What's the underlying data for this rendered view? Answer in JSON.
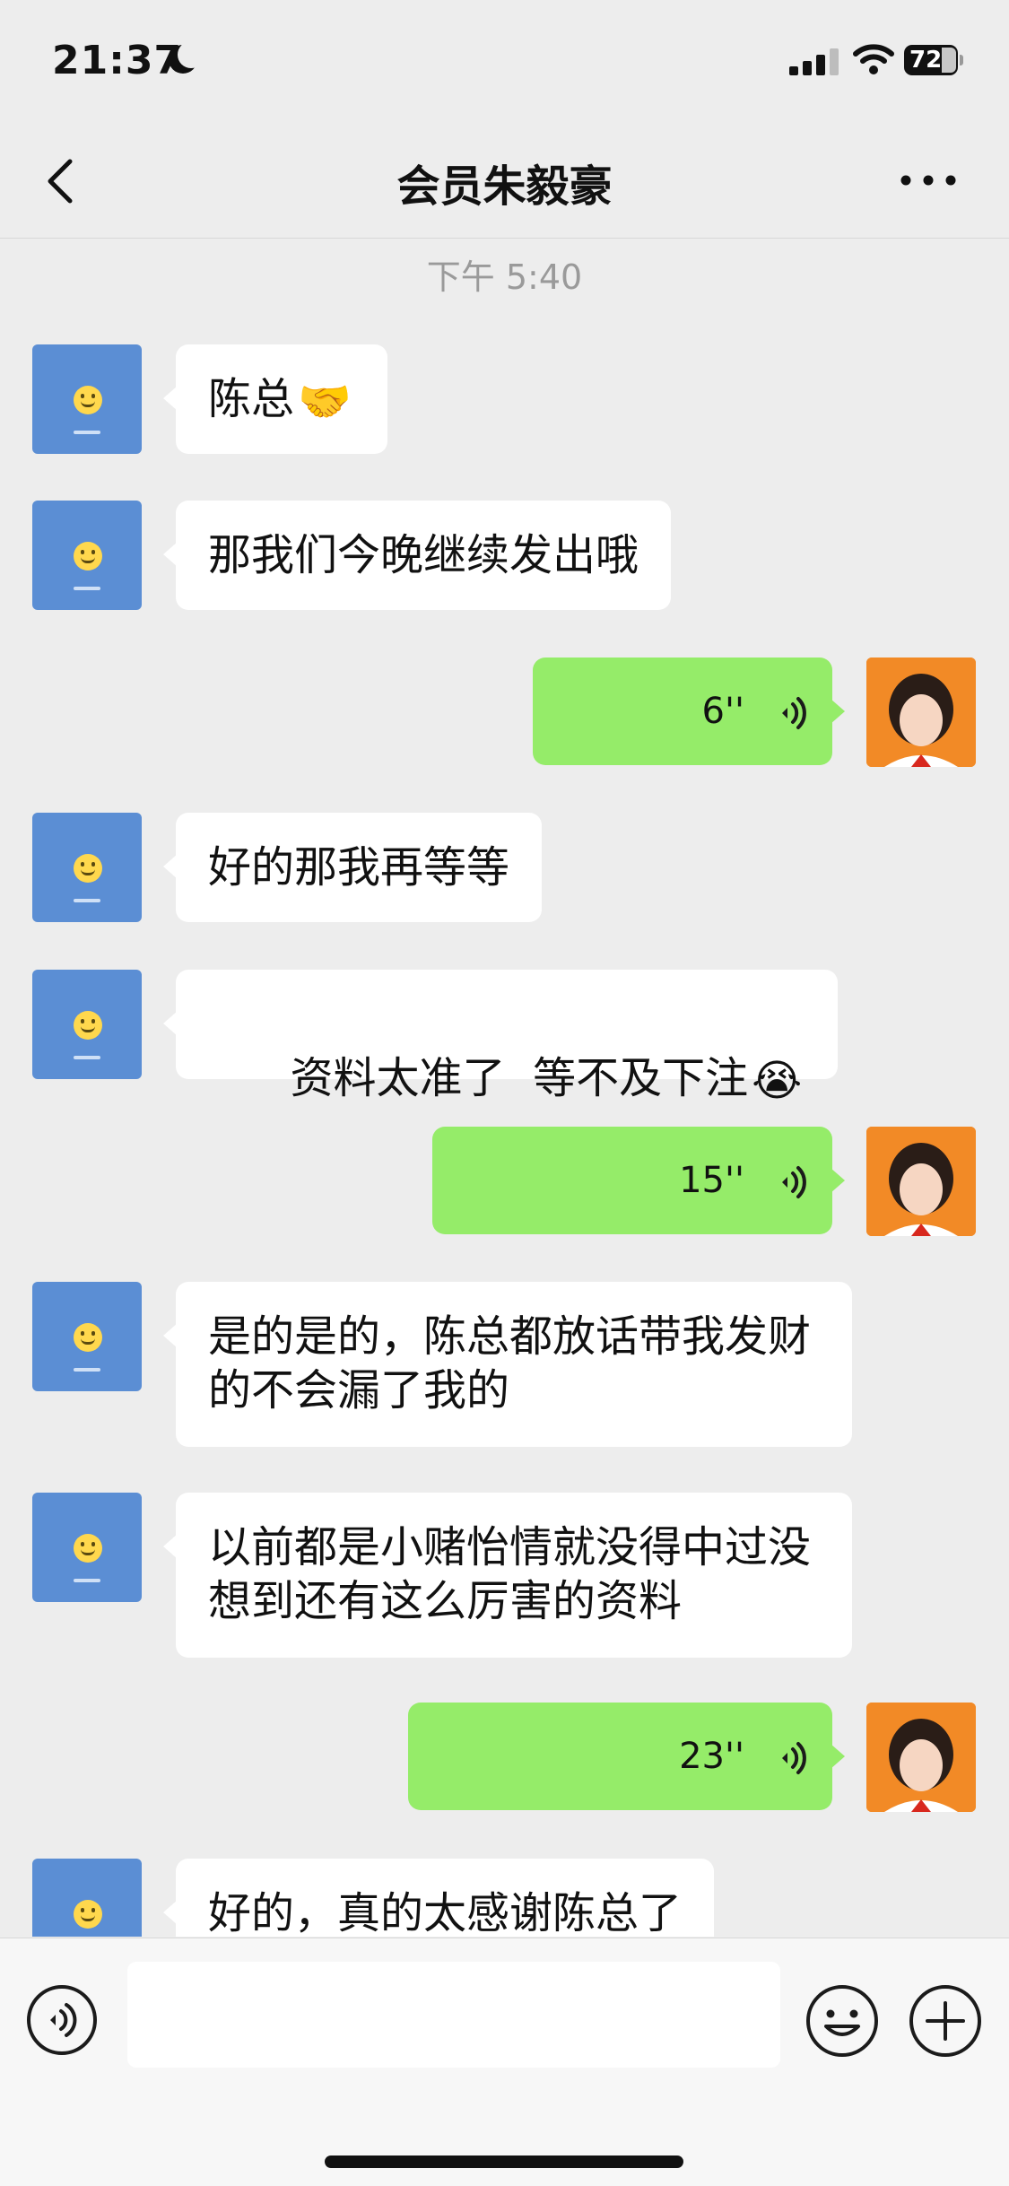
{
  "status_bar": {
    "time": "21:37",
    "battery": "72",
    "battery_fraction": 0.72
  },
  "header": {
    "title": "会员朱毅豪",
    "back_icon": "chevron-left-icon",
    "more_icon": "more-dots-icon"
  },
  "chat": {
    "timestamp": "下午 5:40",
    "messages": [
      {
        "side": "left",
        "type": "text",
        "text": "陈总",
        "emoji": "🤝"
      },
      {
        "side": "left",
        "type": "text",
        "text": "那我们今晚继续发出哦"
      },
      {
        "side": "right",
        "type": "voice",
        "duration": "6''"
      },
      {
        "side": "left",
        "type": "text",
        "text": "好的那我再等等"
      },
      {
        "side": "left",
        "type": "text",
        "text": "资料太准了  等不及下注",
        "emoji": "😭"
      },
      {
        "side": "right",
        "type": "voice",
        "duration": "15''"
      },
      {
        "side": "left",
        "type": "text",
        "text": "是的是的，陈总都放话带我发财的不会漏了我的"
      },
      {
        "side": "left",
        "type": "text",
        "text": "以前都是小赌怡情就没得中过没想到还有这么厉害的资料"
      },
      {
        "side": "right",
        "type": "voice",
        "duration": "23''"
      },
      {
        "side": "left",
        "type": "text",
        "text": "好的，真的太感谢陈总了"
      }
    ]
  },
  "toolbar": {
    "input_value": "",
    "voice_icon": "voice-mode-icon",
    "emoji_icon": "smiley-face-icon",
    "plus_icon": "plus-circle-icon"
  },
  "colors": {
    "background": "#ededed",
    "outgoing_bubble": "#95ec69",
    "incoming_bubble": "#ffffff",
    "avatar_left": "#5b8ed4",
    "avatar_right": "#f28a26"
  }
}
